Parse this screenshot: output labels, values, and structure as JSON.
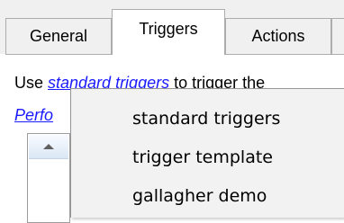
{
  "tabs": [
    {
      "label": "General"
    },
    {
      "label": "Triggers"
    },
    {
      "label": "Actions"
    }
  ],
  "content": {
    "line1_prefix": "Use ",
    "line1_link": "standard triggers",
    "line1_suffix": " to trigger the",
    "line2_link": "Perfo"
  },
  "menu": {
    "items": [
      {
        "label": "standard triggers"
      },
      {
        "label": "trigger template"
      },
      {
        "label": "gallagher demo"
      }
    ]
  }
}
